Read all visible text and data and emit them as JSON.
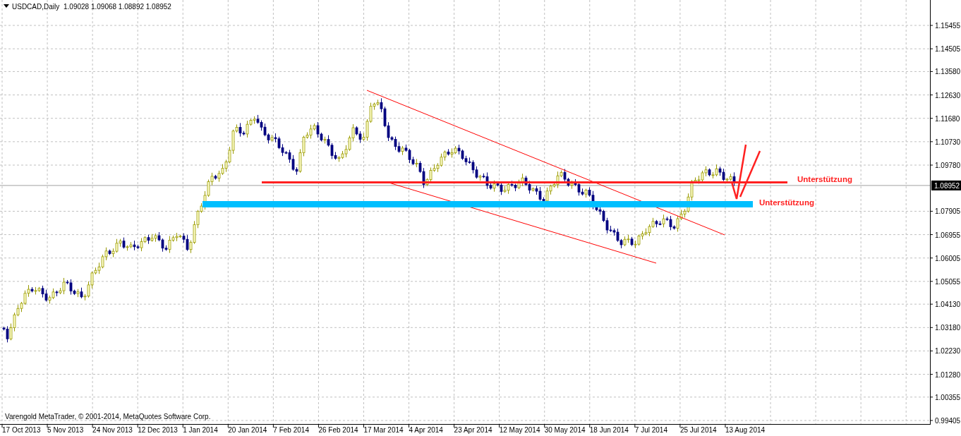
{
  "chart": {
    "symbol": "USDCAD,Daily",
    "ohlc": "1.09028 1.09068 1.08892 1.08952",
    "copyright": "Varengold MetaTrader, © 2001-2014, MetaQuotes Software Corp.",
    "price_axis": [
      "1.15455",
      "1.14505",
      "1.13580",
      "1.12630",
      "1.11680",
      "1.10730",
      "1.09780",
      "1.07905",
      "1.06955",
      "1.06005",
      "1.05055",
      "1.04130",
      "1.03180",
      "1.02230",
      "1.01280",
      "1.00355",
      "0.99405"
    ],
    "current_price": "1.08952",
    "time_axis": [
      "17 Oct 2013",
      "5 Nov 2013",
      "24 Nov 2013",
      "12 Dec 2013",
      "1 Jan 2014",
      "20 Jan 2014",
      "7 Feb 2014",
      "26 Feb 2014",
      "17 Mar 2014",
      "4 Apr 2014",
      "23 Apr 2014",
      "12 May 2014",
      "30 May 2014",
      "18 Jun 2014",
      "7 Jul 2014",
      "25 Jul 2014",
      "13 Aug 2014"
    ],
    "support_lines": [
      {
        "label": "Unterstützung",
        "color": "#ff2020"
      },
      {
        "label": "Unterstützung",
        "color": "#00bfff"
      }
    ]
  }
}
